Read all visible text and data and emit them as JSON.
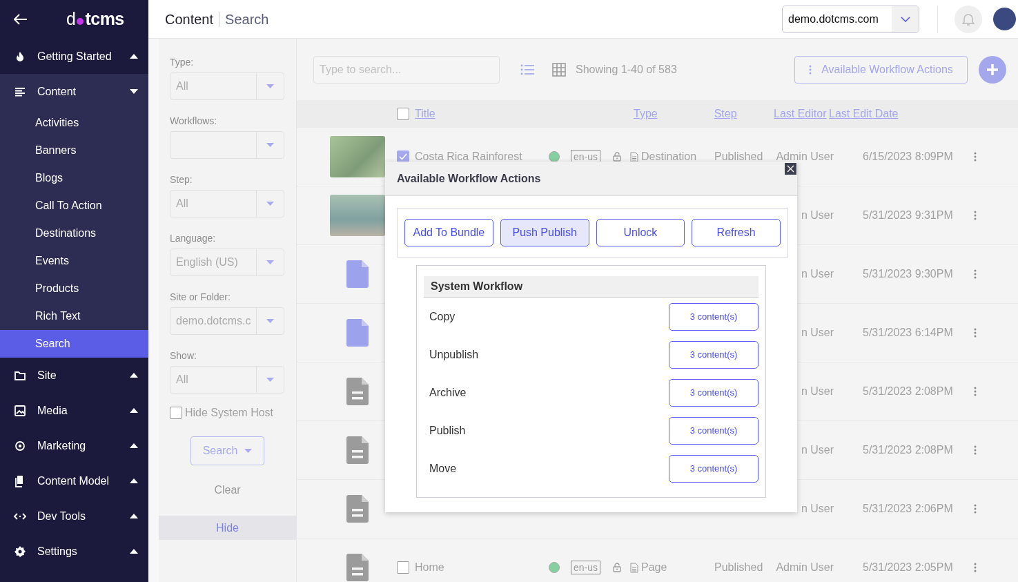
{
  "sidebar": {
    "logo_parts": [
      "d",
      "tcms"
    ],
    "items": [
      {
        "label": "Getting Started",
        "expanded": false
      },
      {
        "label": "Content",
        "expanded": true,
        "children": [
          {
            "label": "Activities",
            "selected": false
          },
          {
            "label": "Banners",
            "selected": false
          },
          {
            "label": "Blogs",
            "selected": false
          },
          {
            "label": "Call To Action",
            "selected": false
          },
          {
            "label": "Destinations",
            "selected": false
          },
          {
            "label": "Events",
            "selected": false
          },
          {
            "label": "Products",
            "selected": false
          },
          {
            "label": "Rich Text",
            "selected": false
          },
          {
            "label": "Search",
            "selected": true
          }
        ]
      },
      {
        "label": "Site",
        "expanded": false
      },
      {
        "label": "Media",
        "expanded": false
      },
      {
        "label": "Marketing",
        "expanded": false
      },
      {
        "label": "Content Model",
        "expanded": false
      },
      {
        "label": "Dev Tools",
        "expanded": false
      },
      {
        "label": "Settings",
        "expanded": false
      }
    ]
  },
  "header": {
    "breadcrumb": [
      "Content",
      "Search"
    ],
    "site_selector": "demo.dotcms.com"
  },
  "filters": {
    "fields": [
      {
        "kind": "select",
        "label": "Type:",
        "value": "All"
      },
      {
        "kind": "select",
        "label": "Workflows:"
      },
      {
        "kind": "select",
        "label": "Step:",
        "value": "All"
      },
      {
        "kind": "select",
        "label": "Language:",
        "value": "English (US)"
      },
      {
        "kind": "select",
        "label": "Site or Folder:",
        "value": "demo.dotcms.c"
      },
      {
        "kind": "select",
        "label": "Show:",
        "value": "All"
      },
      {
        "kind": "checkbox",
        "label": "Hide System Host",
        "checked": false
      }
    ],
    "search_button": "Search",
    "clear": "Clear",
    "hide": "Hide"
  },
  "toolbar": {
    "search": {
      "placeholder": "Type to search..."
    },
    "views": [
      {
        "selected": true
      },
      {
        "selected": false
      }
    ],
    "showing": "Showing 1-40 of 583",
    "workflow_button": "Available Workflow Actions"
  },
  "table": {
    "select_all": false,
    "columns": [
      "Title",
      "Type",
      "Step",
      "Last Editor",
      "Last Edit Date"
    ],
    "rows": [
      {
        "kind": "photo",
        "checked": true,
        "title": "Costa Rica Rainforest",
        "lang": "en-us",
        "type": "Destination",
        "step": "Published",
        "editor": "Admin User",
        "date": "6/15/2023 8:09PM"
      },
      {
        "kind": "photo",
        "editor": "n User",
        "date": "5/31/2023 9:31PM"
      },
      {
        "kind": "file",
        "editor": "n User",
        "date": "5/31/2023 9:30PM"
      },
      {
        "kind": "file",
        "editor": "n User",
        "date": "5/31/2023 6:14PM"
      },
      {
        "kind": "page",
        "editor": "n User",
        "date": "5/31/2023 2:08PM"
      },
      {
        "kind": "page",
        "editor": "n User",
        "date": "5/31/2023 2:08PM"
      },
      {
        "kind": "page",
        "editor": "n User",
        "date": "5/31/2023 2:06PM"
      },
      {
        "kind": "page",
        "checked": false,
        "title": "Home",
        "lang": "en-us",
        "type": "Page",
        "step": "Published",
        "editor": "Admin User",
        "date": "5/31/2023 2:05PM"
      }
    ]
  },
  "dialog": {
    "title": "Available Workflow Actions",
    "actions": [
      {
        "label": "Add To Bundle",
        "selected": false
      },
      {
        "label": "Push Publish",
        "selected": true
      },
      {
        "label": "Unlock",
        "selected": false
      },
      {
        "label": "Refresh",
        "selected": false
      }
    ],
    "workflow": {
      "name": "System Workflow",
      "actions": [
        {
          "label": "Copy",
          "button": "3 content(s)"
        },
        {
          "label": "Unpublish",
          "button": "3 content(s)"
        },
        {
          "label": "Archive",
          "button": "3 content(s)"
        },
        {
          "label": "Publish",
          "button": "3 content(s)"
        },
        {
          "label": "Move",
          "button": "3 content(s)"
        }
      ]
    }
  }
}
